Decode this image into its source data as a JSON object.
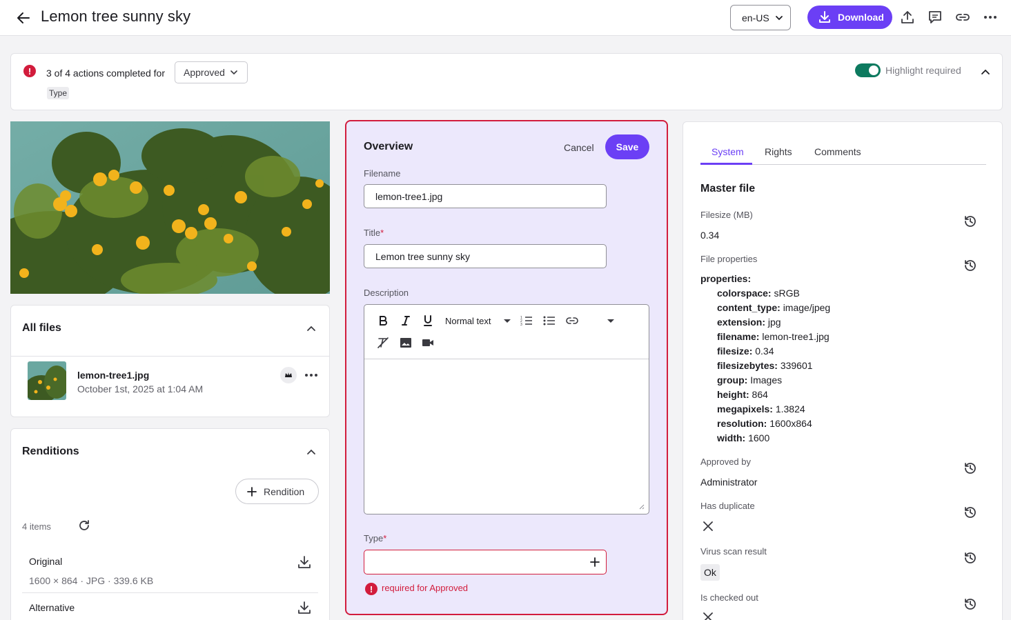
{
  "header": {
    "title": "Lemon tree sunny sky",
    "locale": "en-US",
    "download_label": "Download"
  },
  "status": {
    "summary": "3 of 4 actions completed for",
    "workflow_state": "Approved",
    "pending_chip": "Type",
    "highlight_label": "Highlight required",
    "highlight_on": true
  },
  "all_files": {
    "title": "All files",
    "file": {
      "name": "lemon-tree1.jpg",
      "date": "October 1st, 2025 at 1:04 AM"
    }
  },
  "renditions": {
    "title": "Renditions",
    "add_label": "Rendition",
    "count": "4 items",
    "rows": [
      {
        "label": "Original",
        "meta": "1600 × 864 · JPG · 339.6 KB"
      },
      {
        "label": "Alternative",
        "meta": ""
      }
    ]
  },
  "form": {
    "title": "Overview",
    "cancel_label": "Cancel",
    "save_label": "Save",
    "filename_label": "Filename",
    "filename_value": "lemon-tree1.jpg",
    "title_label": "Title",
    "title_required": "*",
    "title_value": "Lemon tree sunny sky",
    "description_label": "Description",
    "text_style": "Normal text",
    "type_label": "Type",
    "type_required": "*",
    "type_error": "required for Approved"
  },
  "right_panel": {
    "tabs": [
      "System",
      "Rights",
      "Comments"
    ],
    "active_tab": "System",
    "section_title": "Master file",
    "filesize_label": "Filesize (MB)",
    "filesize_value": "0.34",
    "file_properties_label": "File properties",
    "properties_heading": "properties:",
    "properties": [
      {
        "key": "colorspace:",
        "value": "sRGB"
      },
      {
        "key": "content_type:",
        "value": "image/jpeg"
      },
      {
        "key": "extension:",
        "value": "jpg"
      },
      {
        "key": "filename:",
        "value": "lemon-tree1.jpg"
      },
      {
        "key": "filesize:",
        "value": "0.34"
      },
      {
        "key": "filesizebytes:",
        "value": "339601"
      },
      {
        "key": "group:",
        "value": "Images"
      },
      {
        "key": "height:",
        "value": "864"
      },
      {
        "key": "megapixels:",
        "value": "1.3824"
      },
      {
        "key": "resolution:",
        "value": "1600x864"
      },
      {
        "key": "width:",
        "value": "1600"
      }
    ],
    "approved_by_label": "Approved by",
    "approved_by_value": "Administrator",
    "has_duplicate_label": "Has duplicate",
    "virus_scan_label": "Virus scan result",
    "virus_scan_value": "Ok",
    "checked_out_label": "Is checked out"
  },
  "colors": {
    "accent": "#6b3ff5",
    "error": "#d21c3c",
    "toggle_on": "#0d7a5f"
  }
}
